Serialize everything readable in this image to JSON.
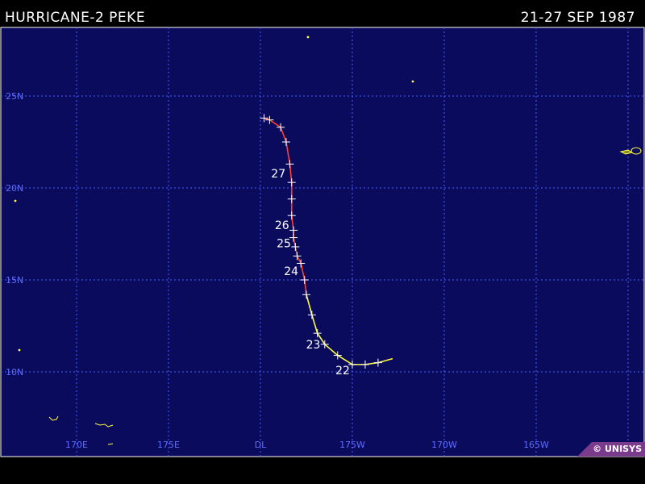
{
  "header": {
    "title": "HURRICANE-2 PEKE",
    "dates": "21-27 SEP 1987"
  },
  "map": {
    "ocean_color": "#0b0b5e",
    "grid_color": "#4a5cff",
    "land_color": "#ffff40",
    "lat_labels": [
      {
        "lat": 25,
        "label": "25N"
      },
      {
        "lat": 20,
        "label": "20N"
      },
      {
        "lat": 15,
        "label": "15N"
      },
      {
        "lat": 10,
        "label": "10N"
      }
    ],
    "lon_labels": [
      {
        "lon": 170,
        "label": "170E"
      },
      {
        "lon": 175,
        "label": "175E"
      },
      {
        "lon": 180,
        "label": "DL"
      },
      {
        "lon": 185,
        "label": "175W"
      },
      {
        "lon": 190,
        "label": "170W"
      },
      {
        "lon": 195,
        "label": "165W"
      }
    ]
  },
  "track": {
    "colors": {
      "storm": "#ffff40",
      "hurricane2": "#ff4030"
    },
    "points": [
      {
        "lon": 186.4,
        "lat": 10.5,
        "cat": "storm"
      },
      {
        "lon": 185.7,
        "lat": 10.4,
        "cat": "storm"
      },
      {
        "lon": 185.0,
        "lat": 10.4,
        "cat": "storm"
      },
      {
        "lon": 184.2,
        "lat": 10.9,
        "cat": "storm"
      },
      {
        "lon": 183.5,
        "lat": 11.5,
        "cat": "storm"
      },
      {
        "lon": 183.1,
        "lat": 12.1,
        "cat": "storm"
      },
      {
        "lon": 182.8,
        "lat": 13.1,
        "cat": "storm"
      },
      {
        "lon": 182.5,
        "lat": 14.2,
        "cat": "storm"
      },
      {
        "lon": 182.4,
        "lat": 15.0,
        "cat": "hurricane2"
      },
      {
        "lon": 182.2,
        "lat": 15.9,
        "cat": "hurricane2"
      },
      {
        "lon": 182.0,
        "lat": 16.3,
        "cat": "hurricane2"
      },
      {
        "lon": 181.9,
        "lat": 16.8,
        "cat": "hurricane2"
      },
      {
        "lon": 181.8,
        "lat": 17.3,
        "cat": "hurricane2"
      },
      {
        "lon": 181.8,
        "lat": 17.7,
        "cat": "hurricane2"
      },
      {
        "lon": 181.7,
        "lat": 18.5,
        "cat": "hurricane2"
      },
      {
        "lon": 181.7,
        "lat": 19.4,
        "cat": "hurricane2"
      },
      {
        "lon": 181.7,
        "lat": 20.3,
        "cat": "hurricane2"
      },
      {
        "lon": 181.6,
        "lat": 21.3,
        "cat": "hurricane2"
      },
      {
        "lon": 181.4,
        "lat": 22.5,
        "cat": "hurricane2"
      },
      {
        "lon": 181.1,
        "lat": 23.3,
        "cat": "hurricane2"
      },
      {
        "lon": 180.5,
        "lat": 23.7,
        "cat": "hurricane2"
      },
      {
        "lon": 180.2,
        "lat": 23.8,
        "cat": "hurricane2"
      }
    ],
    "day_labels": [
      {
        "label": "22",
        "lon": 185.0,
        "lat": 10.4
      },
      {
        "label": "23",
        "lon": 183.4,
        "lat": 11.8
      },
      {
        "label": "24",
        "lon": 182.2,
        "lat": 15.8
      },
      {
        "label": "25",
        "lon": 181.8,
        "lat": 17.3
      },
      {
        "label": "26",
        "lon": 181.7,
        "lat": 18.3
      },
      {
        "label": "27",
        "lon": 181.5,
        "lat": 21.1
      }
    ]
  },
  "copyright": "© UNISYS"
}
